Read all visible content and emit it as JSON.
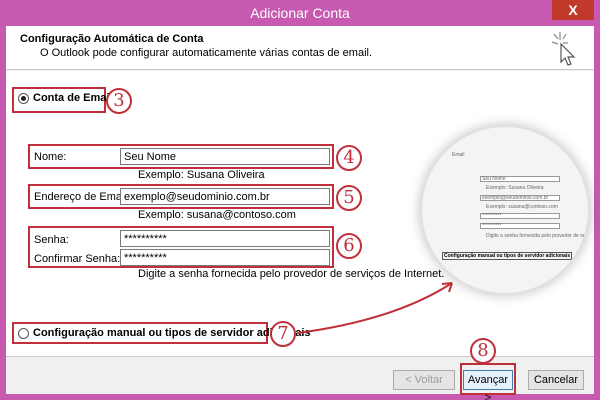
{
  "window": {
    "title": "Adicionar Conta",
    "close_label": "X"
  },
  "header": {
    "title": "Configuração Automática de Conta",
    "subtitle": "O Outlook pode configurar automaticamente várias contas de email."
  },
  "email_account": {
    "label": "Conta de Email",
    "selected": true,
    "badge": "3"
  },
  "fields": {
    "name": {
      "label": "Nome:",
      "value": "Seu Nome",
      "hint": "Exemplo: Susana Oliveira",
      "badge": "4"
    },
    "email": {
      "label": "Endereço de Email:",
      "value": "exemplo@seudominio.com.br",
      "hint": "Exemplo: susana@contoso.com",
      "badge": "5"
    },
    "password": {
      "label": "Senha:",
      "value": "**********"
    },
    "confirm_password": {
      "label": "Confirmar Senha:",
      "value": "**********"
    },
    "password_hint": "Digite a senha fornecida pelo provedor de serviços de Internet.",
    "password_badge": "6"
  },
  "manual": {
    "label": "Configuração manual ou tipos de servidor adicionais",
    "selected": false,
    "badge": "7"
  },
  "footer": {
    "back_label": "< Voltar",
    "next_label": "Avançar >",
    "cancel_label": "Cancelar",
    "next_badge": "8"
  },
  "magnifier": {
    "email_label": "Email",
    "name_value": "Seu Nome",
    "name_hint": "Exemplo: Susana Oliveira",
    "email_value": "exemplo@seudominio.com.br",
    "email_hint": "Exemplo: susana@contoso.com",
    "pw_value": "**********",
    "pw_confirm_value": "**********",
    "pw_hint": "Digite a senha fornecida pelo provedor de serviços de Internet.",
    "manual_label": "Configuração manual ou tipos de servidor adicionais"
  },
  "colors": {
    "title_bar": "#c75ab0",
    "annotation_red": "#c0303a",
    "close_button": "#c0392b"
  }
}
